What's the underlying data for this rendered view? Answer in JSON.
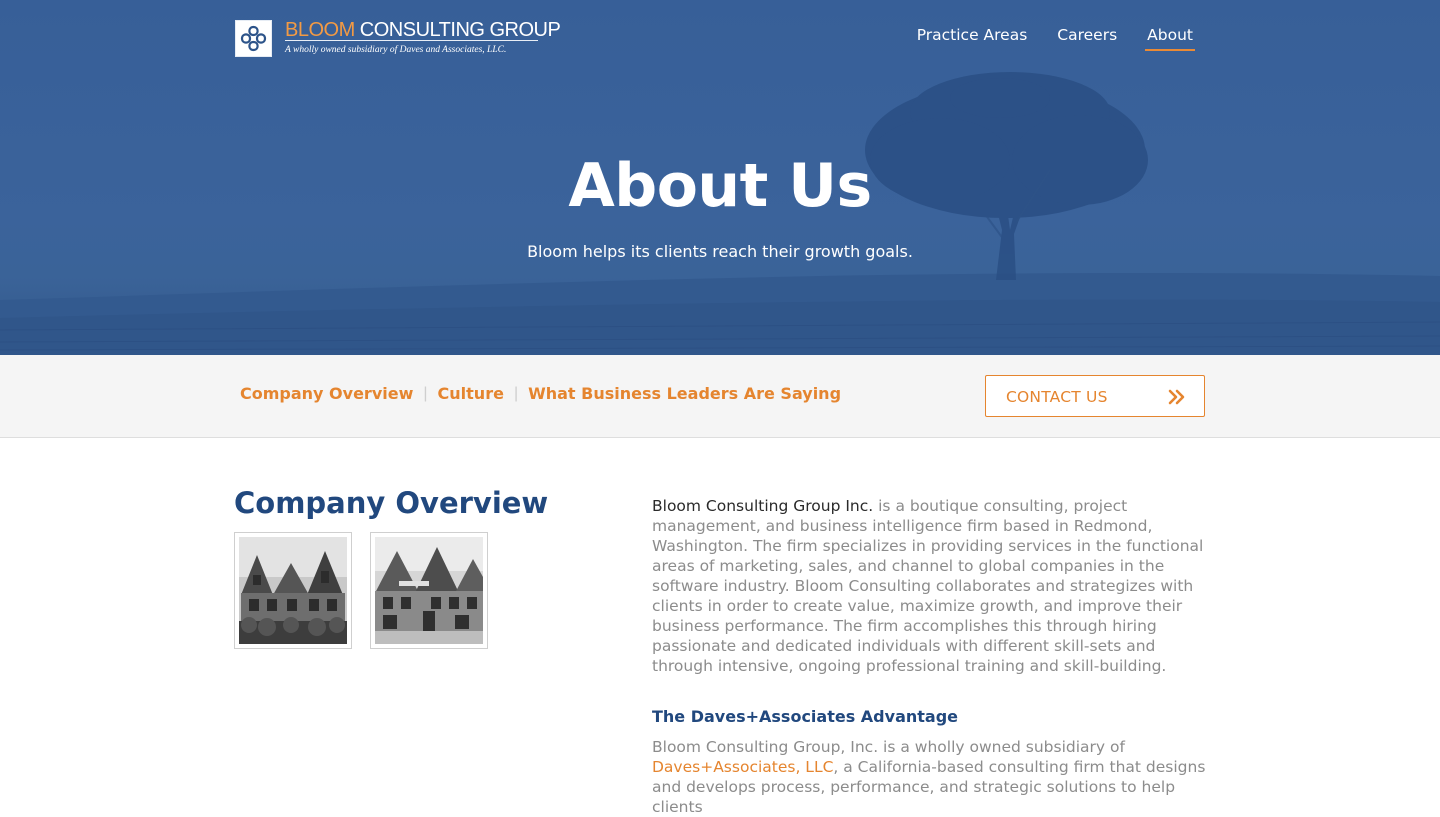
{
  "brand": {
    "name_accent": "BLOOM",
    "name_rest": " CONSULTING GROUP",
    "tagline": "A wholly owned subsidiary of Daves and Associates, LLC."
  },
  "nav": {
    "items": [
      {
        "label": "Practice Areas"
      },
      {
        "label": "Careers"
      },
      {
        "label": "About"
      }
    ],
    "active": "About"
  },
  "hero": {
    "title": "About Us",
    "subtitle": "Bloom helps its clients reach their growth goals."
  },
  "subnav": {
    "items": [
      {
        "label": "Company Overview"
      },
      {
        "label": "Culture"
      },
      {
        "label": "What Business Leaders Are Saying"
      }
    ],
    "separator": "|",
    "contact_label": "CONTACT US"
  },
  "overview": {
    "title": "Company Overview",
    "paragraph1_lead": "Bloom Consulting Group Inc.",
    "paragraph1_rest": " is a boutique consulting, project management, and business intelligence firm based in Redmond, Washington. The firm specializes in providing services in the functional areas of marketing, sales, and channel to global companies in the software industry. Bloom Consulting collaborates and strategizes with clients in order to create value, maximize growth, and improve their business performance. The firm accomplishes this through hiring passionate and dedicated individuals with different skill-sets and through intensive, ongoing professional training and skill-building.",
    "advantage_title": "The Daves+Associates Advantage",
    "paragraph2_start": "Bloom Consulting Group, Inc. is a wholly owned subsidiary of ",
    "paragraph2_link": "Daves+Associates, LLC",
    "paragraph2_rest": ", a California-based consulting firm that designs and develops process, performance, and strategic solutions to help clients"
  },
  "colors": {
    "hero_blue": "#3b639b",
    "accent_orange": "#e5852f",
    "heading_navy": "#21487e",
    "body_gray": "#8c8c8c",
    "subnav_bg": "#f5f5f5"
  },
  "icons": {
    "logo_mark": "ornamental-knot-icon",
    "contact_arrow": "double-chevron-right-icon"
  }
}
